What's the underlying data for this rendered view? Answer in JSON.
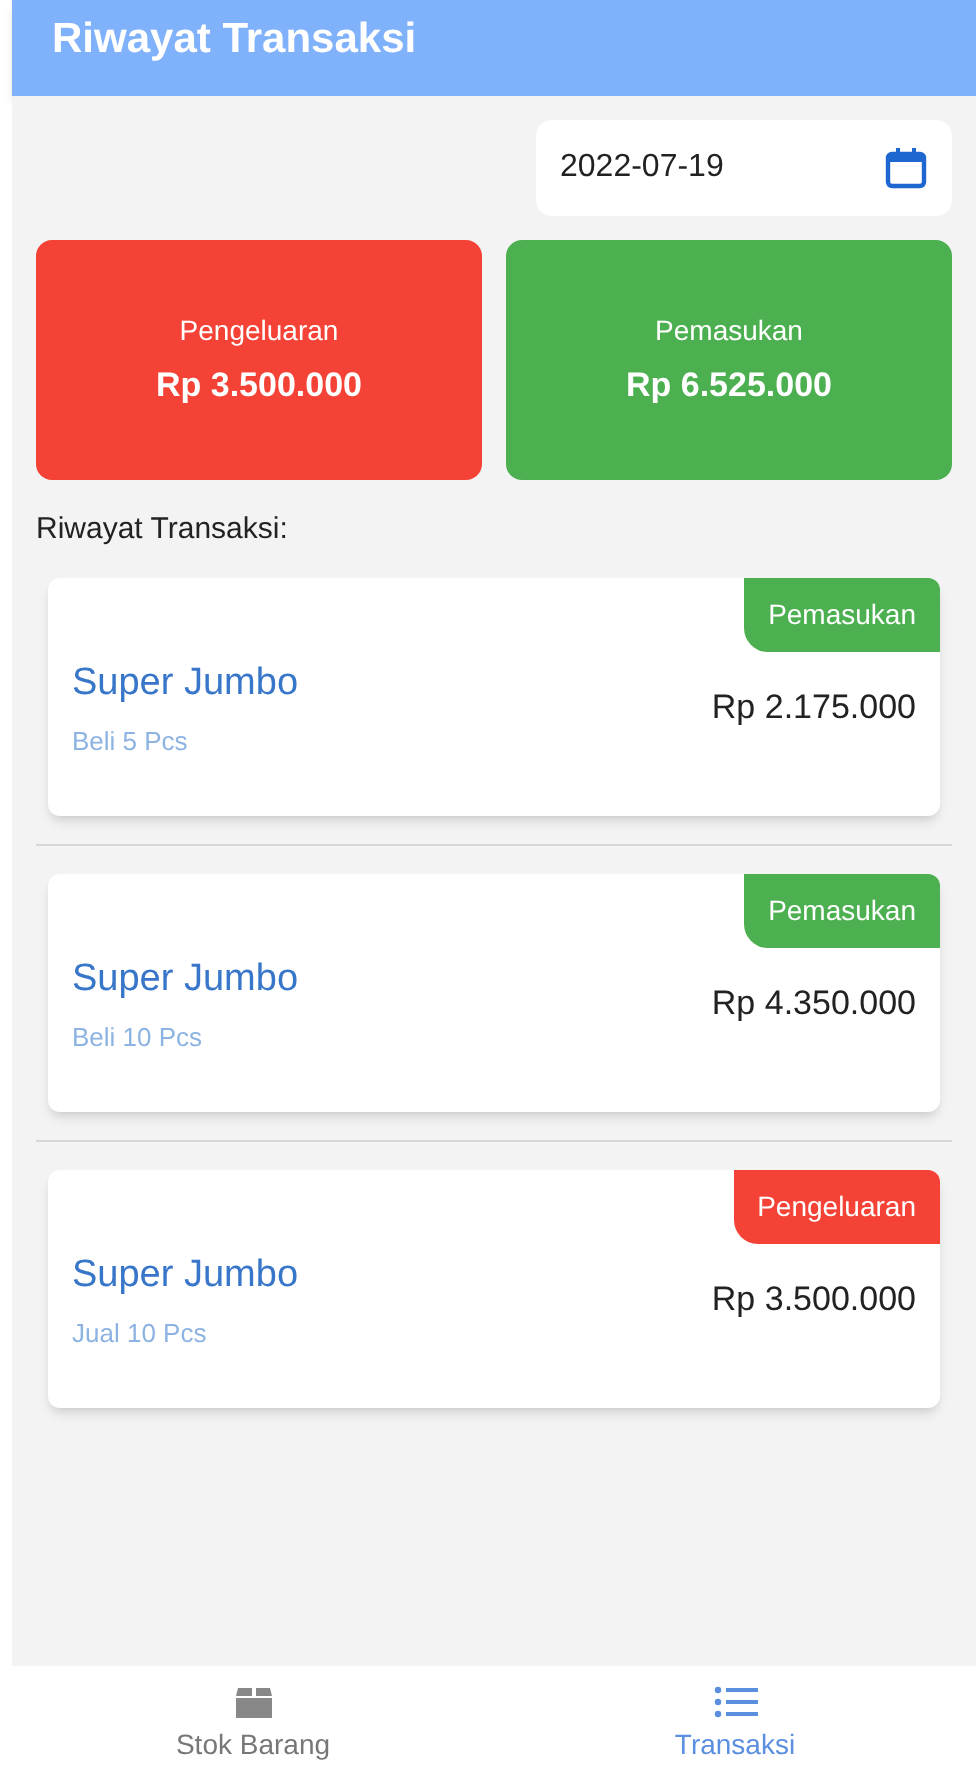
{
  "header": {
    "title": "Riwayat Transaksi"
  },
  "date_field": {
    "value": "2022-07-19"
  },
  "summary": [
    {
      "kind": "expense",
      "label": "Pengeluaran",
      "amount": "Rp 3.500.000"
    },
    {
      "kind": "income",
      "label": "Pemasukan",
      "amount": "Rp 6.525.000"
    }
  ],
  "section_title": "Riwayat Transaksi:",
  "transactions": [
    {
      "kind": "income",
      "badge": "Pemasukan",
      "name": "Super Jumbo",
      "detail": "Beli 5 Pcs",
      "amount": "Rp 2.175.000"
    },
    {
      "kind": "income",
      "badge": "Pemasukan",
      "name": "Super Jumbo",
      "detail": "Beli 10 Pcs",
      "amount": "Rp 4.350.000"
    },
    {
      "kind": "expense",
      "badge": "Pengeluaran",
      "name": "Super Jumbo",
      "detail": "Jual 10 Pcs",
      "amount": "Rp 3.500.000"
    }
  ],
  "bottom_nav": [
    {
      "kind": "stock",
      "label": "Stok Barang",
      "selected": false
    },
    {
      "kind": "transactions",
      "label": "Transaksi",
      "selected": true
    }
  ]
}
